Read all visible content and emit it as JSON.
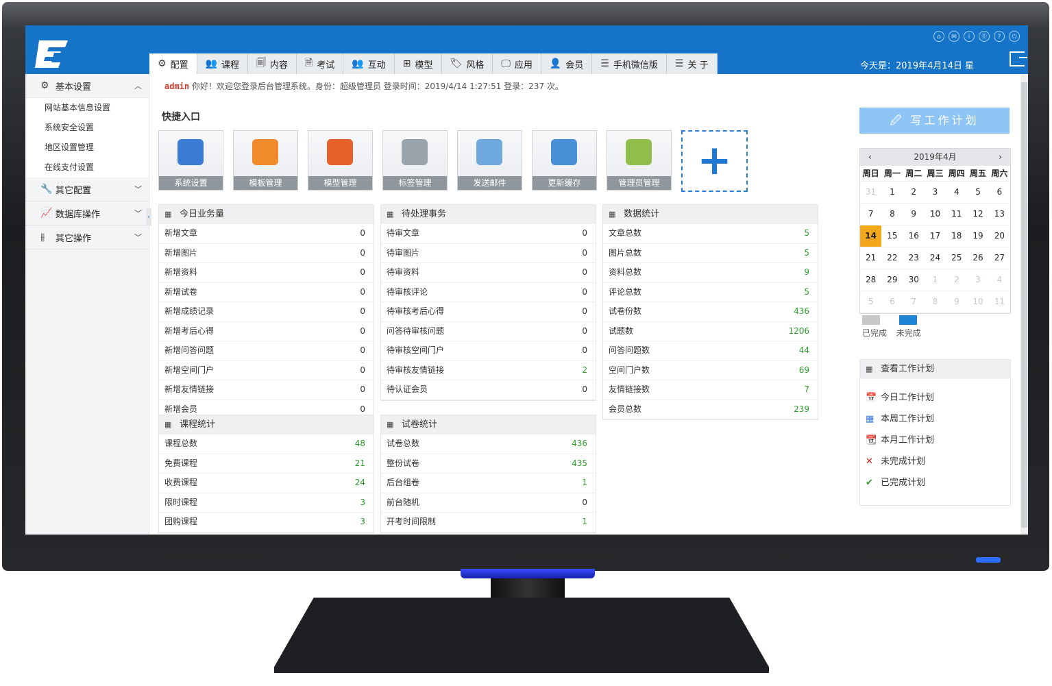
{
  "nav": {
    "items": [
      {
        "label": "配置",
        "icon": "gear-icon",
        "glyph": "⚙"
      },
      {
        "label": "课程",
        "icon": "users-icon",
        "glyph": "👥"
      },
      {
        "label": "内容",
        "icon": "document-icon",
        "glyph": "🗐"
      },
      {
        "label": "考试",
        "icon": "paper-icon",
        "glyph": "🗎"
      },
      {
        "label": "互动",
        "icon": "users-icon",
        "glyph": "👥"
      },
      {
        "label": "模型",
        "icon": "table-icon",
        "glyph": "⊞"
      },
      {
        "label": "风格",
        "icon": "tag-icon",
        "glyph": "🏷"
      },
      {
        "label": "应用",
        "icon": "monitor-icon",
        "glyph": "🖵"
      },
      {
        "label": "会员",
        "icon": "user-icon",
        "glyph": "👤"
      },
      {
        "label": "手机微信版",
        "icon": "menu-icon",
        "glyph": "☰"
      },
      {
        "label": "关 于",
        "icon": "menu-icon",
        "glyph": "☰"
      }
    ],
    "date_text": "今天是：2019年4月14日 星"
  },
  "sidebar": {
    "groups": [
      {
        "label": "基本设置",
        "glyph": "⚙",
        "chevron": "︿",
        "sub": [
          "网站基本信息设置",
          "系统安全设置",
          "地区设置管理",
          "在线支付设置"
        ]
      },
      {
        "label": "其它配置",
        "glyph": "🔧",
        "chevron": "﹀"
      },
      {
        "label": "数据库操作",
        "glyph": "📈",
        "chevron": "﹀"
      },
      {
        "label": "其它操作",
        "glyph": "⫵",
        "chevron": "﹀"
      }
    ]
  },
  "welcome": {
    "user": "admin",
    "text": " 你好！欢迎您登录后台管理系统。身份：超级管理员  登录时间：2019/4/14 1:27:51  登录：237 次。"
  },
  "shortcuts": {
    "title": "快捷入口",
    "items": [
      {
        "label": "系统设置",
        "color": "#3a7bd5"
      },
      {
        "label": "模板管理",
        "color": "#f18a2b"
      },
      {
        "label": "模型管理",
        "color": "#e8602c"
      },
      {
        "label": "标签管理",
        "color": "#9aa4ad"
      },
      {
        "label": "发送邮件",
        "color": "#6fa8dc"
      },
      {
        "label": "更新缓存",
        "color": "#4a90d9"
      },
      {
        "label": "管理员管理",
        "color": "#8fbf4a"
      }
    ],
    "add_label": "+"
  },
  "panels": {
    "today": {
      "title": "今日业务量",
      "rows": [
        {
          "label": "新增文章",
          "value": "0"
        },
        {
          "label": "新增图片",
          "value": "0"
        },
        {
          "label": "新增资料",
          "value": "0"
        },
        {
          "label": "新增试卷",
          "value": "0"
        },
        {
          "label": "新增成绩记录",
          "value": "0"
        },
        {
          "label": "新增考后心得",
          "value": "0"
        },
        {
          "label": "新增问答问题",
          "value": "0"
        },
        {
          "label": "新增空间门户",
          "value": "0"
        },
        {
          "label": "新增友情链接",
          "value": "0"
        },
        {
          "label": "新增会员",
          "value": "0"
        }
      ]
    },
    "pending": {
      "title": "待处理事务",
      "rows": [
        {
          "label": "待审文章",
          "value": "0"
        },
        {
          "label": "待审图片",
          "value": "0"
        },
        {
          "label": "待审资料",
          "value": "0"
        },
        {
          "label": "待审核评论",
          "value": "0"
        },
        {
          "label": "待审核考后心得",
          "value": "0"
        },
        {
          "label": "问答待审核问题",
          "value": "0"
        },
        {
          "label": "待审核空间门户",
          "value": "0"
        },
        {
          "label": "待审核友情链接",
          "value": "2"
        },
        {
          "label": "待认证会员",
          "value": "0"
        }
      ]
    },
    "stats": {
      "title": "数据统计",
      "rows": [
        {
          "label": "文章总数",
          "value": "5"
        },
        {
          "label": "图片总数",
          "value": "5"
        },
        {
          "label": "资料总数",
          "value": "9"
        },
        {
          "label": "评论总数",
          "value": "5"
        },
        {
          "label": "试卷份数",
          "value": "436"
        },
        {
          "label": "试题数",
          "value": "1206"
        },
        {
          "label": "问答问题数",
          "value": "44"
        },
        {
          "label": "空间门户数",
          "value": "69"
        },
        {
          "label": "友情链接数",
          "value": "7"
        },
        {
          "label": "会员总数",
          "value": "239"
        }
      ]
    },
    "course": {
      "title": "课程统计",
      "rows": [
        {
          "label": "课程总数",
          "value": "48"
        },
        {
          "label": "免费课程",
          "value": "21"
        },
        {
          "label": "收费课程",
          "value": "24"
        },
        {
          "label": "限时课程",
          "value": "3"
        },
        {
          "label": "团购课程",
          "value": "3"
        }
      ]
    },
    "exam": {
      "title": "试卷统计",
      "rows": [
        {
          "label": "试卷总数",
          "value": "436"
        },
        {
          "label": "整份试卷",
          "value": "435"
        },
        {
          "label": "后台组卷",
          "value": "1"
        },
        {
          "label": "前台随机",
          "value": "0"
        },
        {
          "label": "开考时间限制",
          "value": "1"
        }
      ]
    }
  },
  "plan_button": "写工作计划",
  "calendar": {
    "title": "2019年4月",
    "prev": "‹",
    "next": "›",
    "weekdays": [
      "周日",
      "周一",
      "周二",
      "周三",
      "周四",
      "周五",
      "周六"
    ],
    "days": [
      "31",
      "1",
      "2",
      "3",
      "4",
      "5",
      "6",
      "7",
      "8",
      "9",
      "10",
      "11",
      "12",
      "13",
      "14",
      "15",
      "16",
      "17",
      "18",
      "19",
      "20",
      "21",
      "22",
      "23",
      "24",
      "25",
      "26",
      "27",
      "28",
      "29",
      "30",
      "1",
      "2",
      "3",
      "4",
      "5",
      "6",
      "7",
      "8",
      "9",
      "10",
      "11"
    ],
    "dim_indices": [
      0,
      31,
      32,
      33,
      34,
      35,
      36,
      37,
      38,
      39,
      40,
      41
    ],
    "today_index": 14
  },
  "legend": {
    "done": {
      "label": "已完成",
      "color": "#c8c8c8"
    },
    "undone": {
      "label": "未完成",
      "color": "#1f85d6"
    }
  },
  "plan_panel": {
    "title": "查看工作计划",
    "items": [
      {
        "label": "今日工作计划",
        "glyph": "📅",
        "color": "#d9534f"
      },
      {
        "label": "本周工作计划",
        "glyph": "▦",
        "color": "#3a7bd5"
      },
      {
        "label": "本月工作计划",
        "glyph": "📆",
        "color": "#d9534f"
      },
      {
        "label": "未完成计划",
        "glyph": "✕",
        "color": "#e02020"
      },
      {
        "label": "已完成计划",
        "glyph": "✔",
        "color": "#2e9a2e"
      }
    ]
  },
  "colors": {
    "topbar": "#1574c7",
    "accent_green": "#2e9a2e",
    "today_highlight": "#f3a81b"
  }
}
